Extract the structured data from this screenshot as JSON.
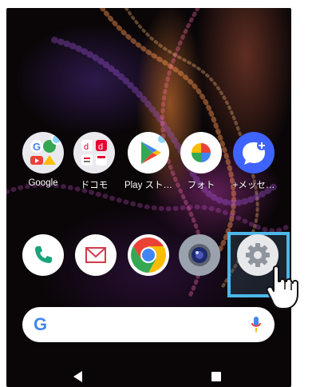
{
  "apps_row1": [
    {
      "label": "Google",
      "icon": "google-folder-icon"
    },
    {
      "label": "ドコモ",
      "icon": "docomo-folder-icon"
    },
    {
      "label": "Play スト…",
      "icon": "play-store-icon"
    },
    {
      "label": "フォト",
      "icon": "photos-icon"
    },
    {
      "label": "+メッセ…",
      "icon": "plus-message-icon"
    }
  ],
  "dock": [
    {
      "icon": "phone-icon"
    },
    {
      "icon": "mail-icon"
    },
    {
      "icon": "chrome-icon"
    },
    {
      "icon": "camera-icon"
    },
    {
      "icon": "settings-icon"
    }
  ],
  "search": {
    "logo": "G",
    "icon": "mic-icon"
  },
  "nav": {
    "back": "back-icon",
    "recents": "recents-icon"
  },
  "colors": {
    "highlight": "#4db7e8",
    "google_blue": "#4285F4",
    "google_red": "#EA4335",
    "google_yellow": "#FBBC05",
    "google_green": "#34A853"
  }
}
